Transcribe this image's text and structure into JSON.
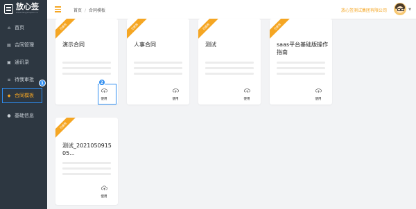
{
  "app": {
    "logo_name": "放心签",
    "logo_sub": "www.fangxinqian.cn"
  },
  "sidebar": {
    "items": [
      {
        "label": "首页",
        "icon": "home-icon",
        "glyph": "⌂"
      },
      {
        "label": "合同管理",
        "icon": "file-icon",
        "glyph": "▤"
      },
      {
        "label": "通讯录",
        "icon": "contacts-icon",
        "glyph": "▣"
      },
      {
        "label": "待我审批",
        "icon": "list-icon",
        "glyph": "≡"
      },
      {
        "label": "合同模板",
        "icon": "template-icon",
        "glyph": "◆"
      },
      {
        "label": "基础信息",
        "icon": "user-icon",
        "glyph": "●"
      }
    ],
    "active_index": 4
  },
  "header": {
    "breadcrumb": [
      "首页",
      "合同模板"
    ],
    "breadcrumb_sep": "/",
    "company": "放心签测试集团有限公司"
  },
  "steps": {
    "one": "1",
    "two": "2"
  },
  "cards": [
    {
      "ribbon": "已使用",
      "title": "演示合同",
      "use_label": "使用"
    },
    {
      "ribbon": "已使用",
      "title": "人事合同",
      "use_label": "使用"
    },
    {
      "ribbon": "已使用",
      "title": "测试",
      "use_label": "使用"
    },
    {
      "ribbon": "已使用",
      "title": "saas平台基础版操作指南",
      "use_label": "使用"
    },
    {
      "ribbon": "已使用",
      "title": "测试_202105091505...",
      "use_label": "使用"
    }
  ],
  "colors": {
    "accent": "#f5a623",
    "sidebar_bg": "#2d3741",
    "highlight": "#2d8cf0"
  }
}
